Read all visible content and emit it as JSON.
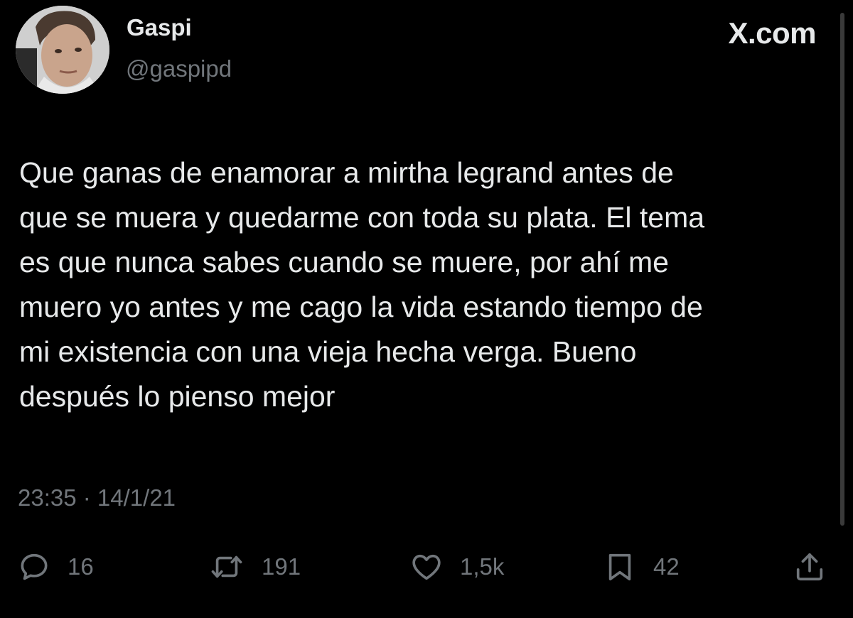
{
  "author": {
    "display_name": "Gaspi",
    "handle": "@gaspipd"
  },
  "site_mark": "X.com",
  "tweet": {
    "text_lines": [
      "Que ganas de enamorar a mirtha legrand antes de",
      "que se muera y quedarme con toda su plata. El tema",
      "es que nunca sabes cuando se muere, por ahí me",
      "muero yo antes y me cago la vida estando tiempo de",
      "mi existencia con una vieja hecha verga. Bueno",
      "después lo pienso mejor"
    ],
    "time": "23:35",
    "separator": " · ",
    "date": "14/1/21"
  },
  "actions": {
    "replies": "16",
    "reposts": "191",
    "likes": "1,5k",
    "bookmarks": "42"
  },
  "icons": {
    "reply": "speech-bubble-icon",
    "repost": "repost-arrows-icon",
    "like": "heart-icon",
    "bookmark": "bookmark-icon",
    "share": "share-upload-icon"
  },
  "colors": {
    "background": "#000000",
    "primary_text": "#e7e9ea",
    "secondary_text": "#71767b"
  }
}
